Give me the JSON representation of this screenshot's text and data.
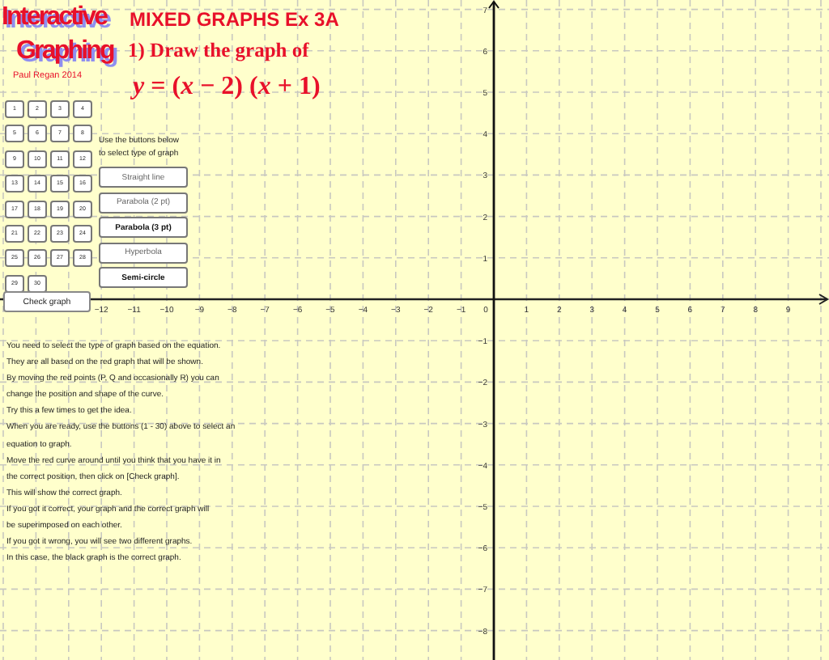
{
  "logo": {
    "line_1": "Interactive",
    "line_2": "Graphing"
  },
  "title": "MIXED GRAPHS Ex 3A",
  "question": "1) Draw the graph of",
  "equation": "*y* = (*x* − 2) (*x* + 1)",
  "author": "Paul Regan 2014",
  "number_buttons": [
    "1",
    "2",
    "3",
    "4",
    "5",
    "6",
    "7",
    "8",
    "9",
    "10",
    "11",
    "12",
    "13",
    "14",
    "15",
    "16",
    "17",
    "18",
    "19",
    "20",
    "21",
    "22",
    "23",
    "24",
    "25",
    "26",
    "27",
    "28",
    "29",
    "30"
  ],
  "hint_lines": [
    "Use the buttons below",
    "to select type of graph"
  ],
  "graph_buttons": [
    {
      "label": "Straight line",
      "disabled": true
    },
    {
      "label": "Parabola (2 pt)",
      "disabled": true
    },
    {
      "label": "Parabola (3 pt)",
      "disabled": false
    },
    {
      "label": "Hyperbola",
      "disabled": true
    },
    {
      "label": "Semi-circle",
      "disabled": false
    }
  ],
  "check_button": "Check graph",
  "x_axis": {
    "negative": [
      "−12",
      "−11",
      "−10",
      "−9",
      "−8",
      "−7",
      "−6",
      "−5",
      "−4",
      "−3",
      "−2",
      "−1"
    ],
    "zero": "0",
    "positive": [
      "1",
      "2",
      "3",
      "4",
      "5",
      "6",
      "7",
      "8",
      "9"
    ]
  },
  "y_axis": {
    "positive": [
      "7",
      "6",
      "5",
      "4",
      "3",
      "2",
      "1"
    ],
    "negative": [
      "−1",
      "−2",
      "−3",
      "−4",
      "−5",
      "−6",
      "−7",
      "−8"
    ]
  },
  "instructions": [
    "You need to select the type of graph based on the equation.",
    "They are all based on the red graph that will be shown.",
    "By moving the red points (P, Q and occasionally R) you can",
    "change the position and shape of the curve.",
    "Try this a few times to get the idea.",
    "When you are ready, use the buttons (1 - 30) above to select  an",
    "equation to graph.",
    "Move the red curve around until you think that you have it in",
    "the correct position, then click on [Check graph].",
    "This will show the correct graph.",
    "If you got it correct, your graph and the correct graph will",
    "be superimposed on each other.",
    "If you got it wrong, you will see two different graphs.",
    "In this case, the black graph is the correct graph."
  ]
}
